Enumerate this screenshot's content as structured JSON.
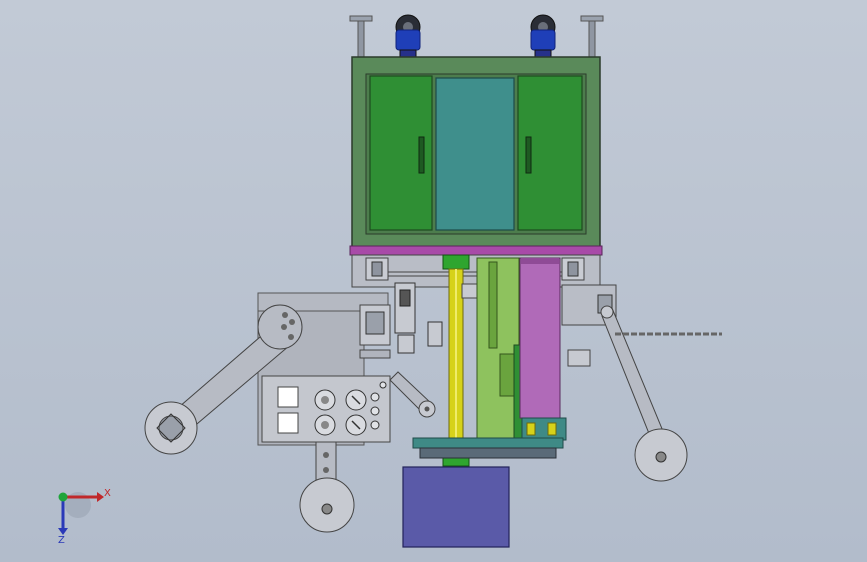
{
  "viewport": {
    "background_top": "#c2cad6",
    "background_bottom": "#b2bccb"
  },
  "triad": {
    "x_label": "X",
    "z_label": "Z",
    "x_color": "#c0282a",
    "y_color": "#1fa53a",
    "z_color": "#2a39b8"
  },
  "colors": {
    "cabinet_frame": "#5a8a5a",
    "cabinet_door": "#2f8f34",
    "cabinet_glass": "#3f8f8c",
    "magenta_band": "#a84aa8",
    "yellow_column": "#d6d21a",
    "green_slide": "#8ec25e",
    "purple_slide": "#b06ab8",
    "base_teal": "#3f8a86",
    "blue_block": "#5a5aa8",
    "wheel_blue": "#1f3fb8",
    "steel": "#a8adb8",
    "panel_gray": "#b9bdc6"
  }
}
